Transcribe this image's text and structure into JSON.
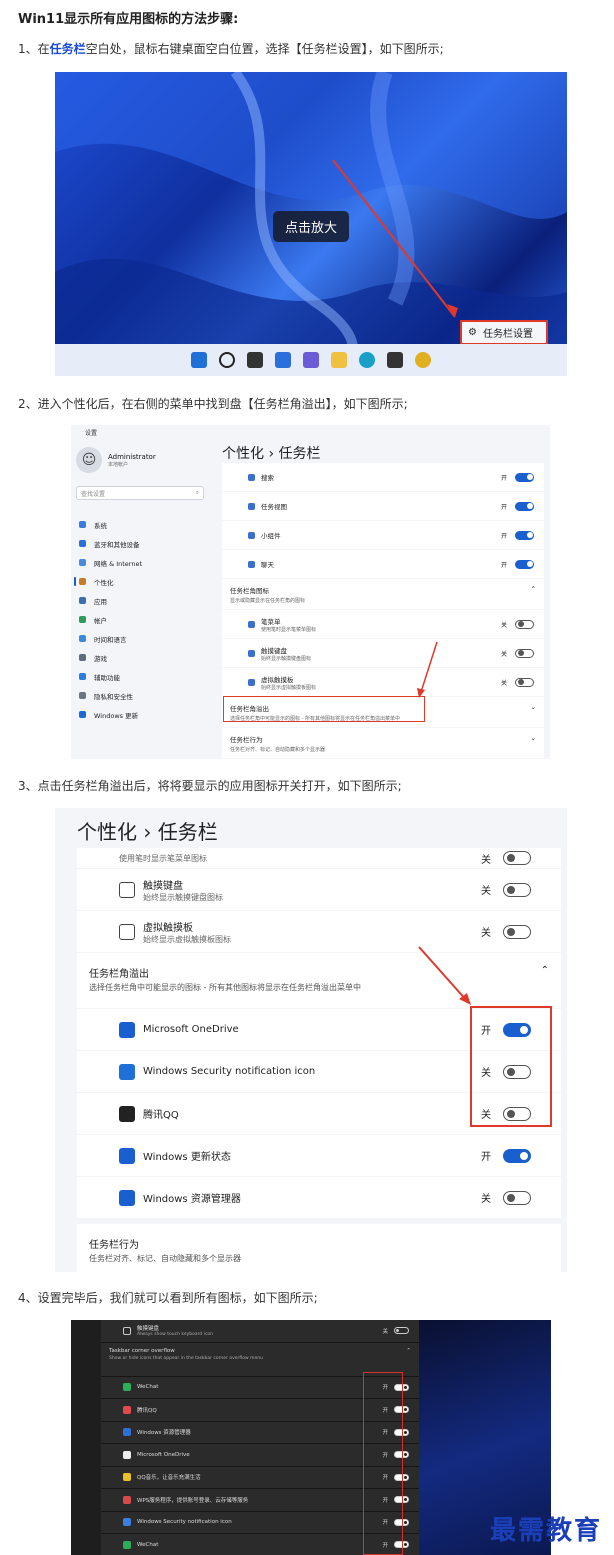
{
  "title": "Win11显示所有应用图标的方法步骤:",
  "steps": {
    "s1_prefix": "1、在",
    "s1_bold": "任务栏",
    "s1_suffix": "空白处，鼠标右键桌面空白位置，选择【任务栏设置】，如下图所示;",
    "s2": "2、进入个性化后，在右侧的菜单中找到盘【任务栏角溢出】，如下图所示;",
    "s3": "3、点击任务栏角溢出后，将将要显示的应用图标开关打开，如下图所示;",
    "s4": "4、设置完毕后，我们就可以看到所有图标，如下图所示;"
  },
  "fig1": {
    "zoom_label": "点击放大",
    "context_menu_item": "任务栏设置",
    "taskbar_icons": [
      "windows-icon",
      "search-icon",
      "task-view-icon",
      "widgets-icon",
      "chat-icon",
      "explorer-icon",
      "edge-icon",
      "store-icon",
      "chrome-icon"
    ]
  },
  "fig2": {
    "window_title": "设置",
    "user_name": "Administrator",
    "user_sub": "本地帐户",
    "search_placeholder": "查找设置",
    "nav": [
      {
        "label": "系统",
        "color": "#3b7ddd"
      },
      {
        "label": "蓝牙和其他设备",
        "color": "#2a6fdb"
      },
      {
        "label": "网络 & Internet",
        "color": "#4a8be0"
      },
      {
        "label": "个性化",
        "color": "#c57d2a"
      },
      {
        "label": "应用",
        "color": "#3a6fb0"
      },
      {
        "label": "帐户",
        "color": "#2f9a5a"
      },
      {
        "label": "时间和语言",
        "color": "#3a8ad9"
      },
      {
        "label": "游戏",
        "color": "#5c6b80"
      },
      {
        "label": "辅助功能",
        "color": "#2b7de0"
      },
      {
        "label": "隐私和安全性",
        "color": "#6a7483"
      },
      {
        "label": "Windows 更新",
        "color": "#1b6ad1"
      }
    ],
    "breadcrumb": "个性化  ›  任务栏",
    "rows_top": [
      {
        "label": "搜索",
        "state": "开",
        "on": true
      },
      {
        "label": "任务视图",
        "state": "开",
        "on": true
      },
      {
        "label": "小组件",
        "state": "开",
        "on": true
      },
      {
        "label": "聊天",
        "state": "开",
        "on": true
      }
    ],
    "corner_icons_title": "任务栏角图标",
    "corner_icons_sub": "显示或隐藏显示在任务栏角的图标",
    "corner_rows": [
      {
        "label": "笔菜单",
        "sub": "使用笔时显示笔菜单图标",
        "state": "关",
        "on": false
      },
      {
        "label": "触摸键盘",
        "sub": "始终显示触摸键盘图标",
        "state": "关",
        "on": false
      },
      {
        "label": "虚拟触摸板",
        "sub": "始终显示虚拟触摸板图标",
        "state": "关",
        "on": false
      }
    ],
    "overflow_title": "任务栏角溢出",
    "overflow_sub": "选择任务栏角中可能显示的图标 - 所有其他图标将显示在任务栏角溢出菜单中",
    "behavior_title": "任务栏行为",
    "behavior_sub": "任务栏对齐、标记、自动隐藏和多个显示器"
  },
  "fig3": {
    "breadcrumb": "个性化  ›  任务栏",
    "pen_sub": "使用笔时显示笔菜单图标",
    "pen_state": "关",
    "rows_top": [
      {
        "label": "触摸键盘",
        "sub": "始终显示触摸键盘图标",
        "state": "关",
        "on": false,
        "icon": "keyboard-icon"
      },
      {
        "label": "虚拟触摸板",
        "sub": "始终显示虚拟触摸板图标",
        "state": "关",
        "on": false,
        "icon": "touchpad-icon"
      }
    ],
    "overflow_title": "任务栏角溢出",
    "overflow_sub": "选择任务栏角中可能显示的图标 - 所有其他图标将显示在任务栏角溢出菜单中",
    "overflow_rows": [
      {
        "label": "Microsoft OneDrive",
        "state": "开",
        "on": true,
        "icon": "onedrive-icon",
        "color": "#1a5fd0"
      },
      {
        "label": "Windows Security notification icon",
        "state": "关",
        "on": false,
        "icon": "security-icon",
        "color": "#1f6fd6"
      },
      {
        "label": "腾讯QQ",
        "state": "关",
        "on": false,
        "icon": "qq-icon",
        "color": "#222222"
      },
      {
        "label": "Windows 更新状态",
        "state": "开",
        "on": true,
        "icon": "update-icon",
        "color": "#1a5fd0"
      },
      {
        "label": "Windows 资源管理器",
        "state": "关",
        "on": false,
        "icon": "explorer-icon",
        "color": "#1a5fd0"
      }
    ],
    "behavior_title": "任务栏行为",
    "behavior_sub": "任务栏对齐、标记、自动隐藏和多个显示器"
  },
  "fig4": {
    "top_row": {
      "label": "触摸键盘",
      "sub": "Always show touch keyboard icon",
      "state": "关"
    },
    "section_title": "Taskbar corner overflow",
    "section_sub": "Show or hide icons that appear in the taskbar corner overflow menu",
    "rows": [
      {
        "label": "WeChat",
        "state": "开",
        "color": "#2aae5a"
      },
      {
        "label": "腾讯QQ",
        "state": "开",
        "color": "#e04a4a"
      },
      {
        "label": "Windows 资源管理器",
        "state": "开",
        "color": "#2f6fd0"
      },
      {
        "label": "Microsoft OneDrive",
        "state": "开",
        "color": "#eeeeee"
      },
      {
        "label": "QQ音乐，让音乐充满生活",
        "state": "开",
        "color": "#e8c22a"
      },
      {
        "label": "WPS服务程序，提供账号登录、云存储等服务",
        "state": "开",
        "color": "#d84a4a"
      },
      {
        "label": "Windows Security notification icon",
        "state": "开",
        "color": "#3a7fe0"
      },
      {
        "label": "WeChat",
        "state": "开",
        "color": "#2aae5a"
      }
    ]
  },
  "watermark": "最需教育"
}
